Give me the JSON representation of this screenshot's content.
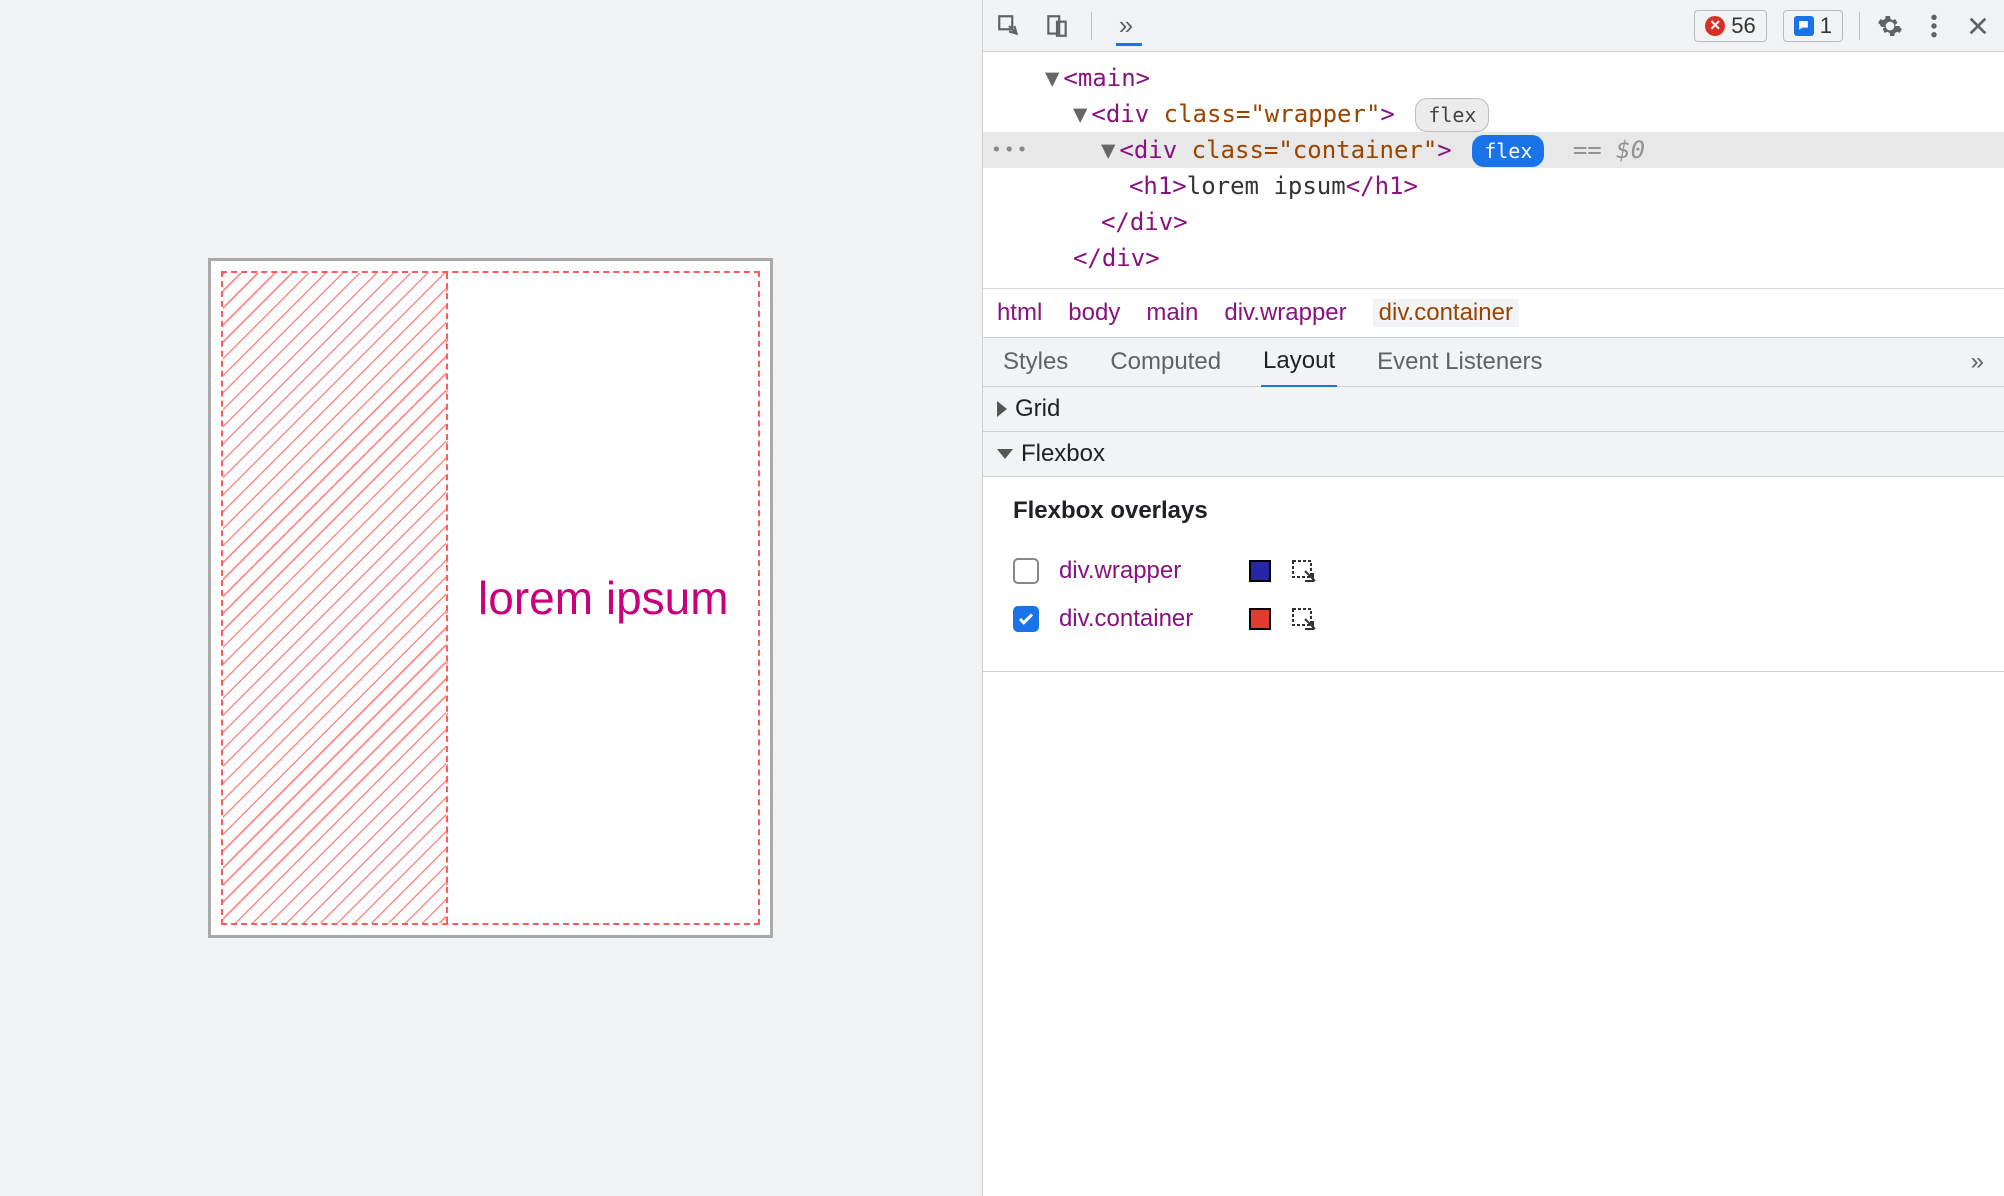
{
  "viewport": {
    "heading": "lorem ipsum"
  },
  "toolbar": {
    "errors_count": "56",
    "msg_count": "1"
  },
  "dom": {
    "l1": {
      "open": "<main>"
    },
    "l2": {
      "open": "<div ",
      "attr": "class=\"wrapper\"",
      "close": ">",
      "pill": "flex"
    },
    "l3": {
      "open": "<div ",
      "attr": "class=\"container\"",
      "close": ">",
      "pill": "flex",
      "trail": "== $0"
    },
    "l4": {
      "open": "<h1>",
      "text": "lorem ipsum",
      "close": "</h1>"
    },
    "l5": {
      "close_div1": "</div>"
    },
    "l6": {
      "close_div2": "</div>"
    }
  },
  "crumbs": [
    "html",
    "body",
    "main",
    "div.wrapper",
    "div.container"
  ],
  "tabs": [
    "Styles",
    "Computed",
    "Layout",
    "Event Listeners"
  ],
  "sections": {
    "grid": "Grid",
    "flexbox": "Flexbox",
    "overlays_title": "Flexbox overlays"
  },
  "overlays": [
    {
      "label": "div.wrapper",
      "checked": false,
      "color": "blue"
    },
    {
      "label": "div.container",
      "checked": true,
      "color": "red"
    }
  ]
}
